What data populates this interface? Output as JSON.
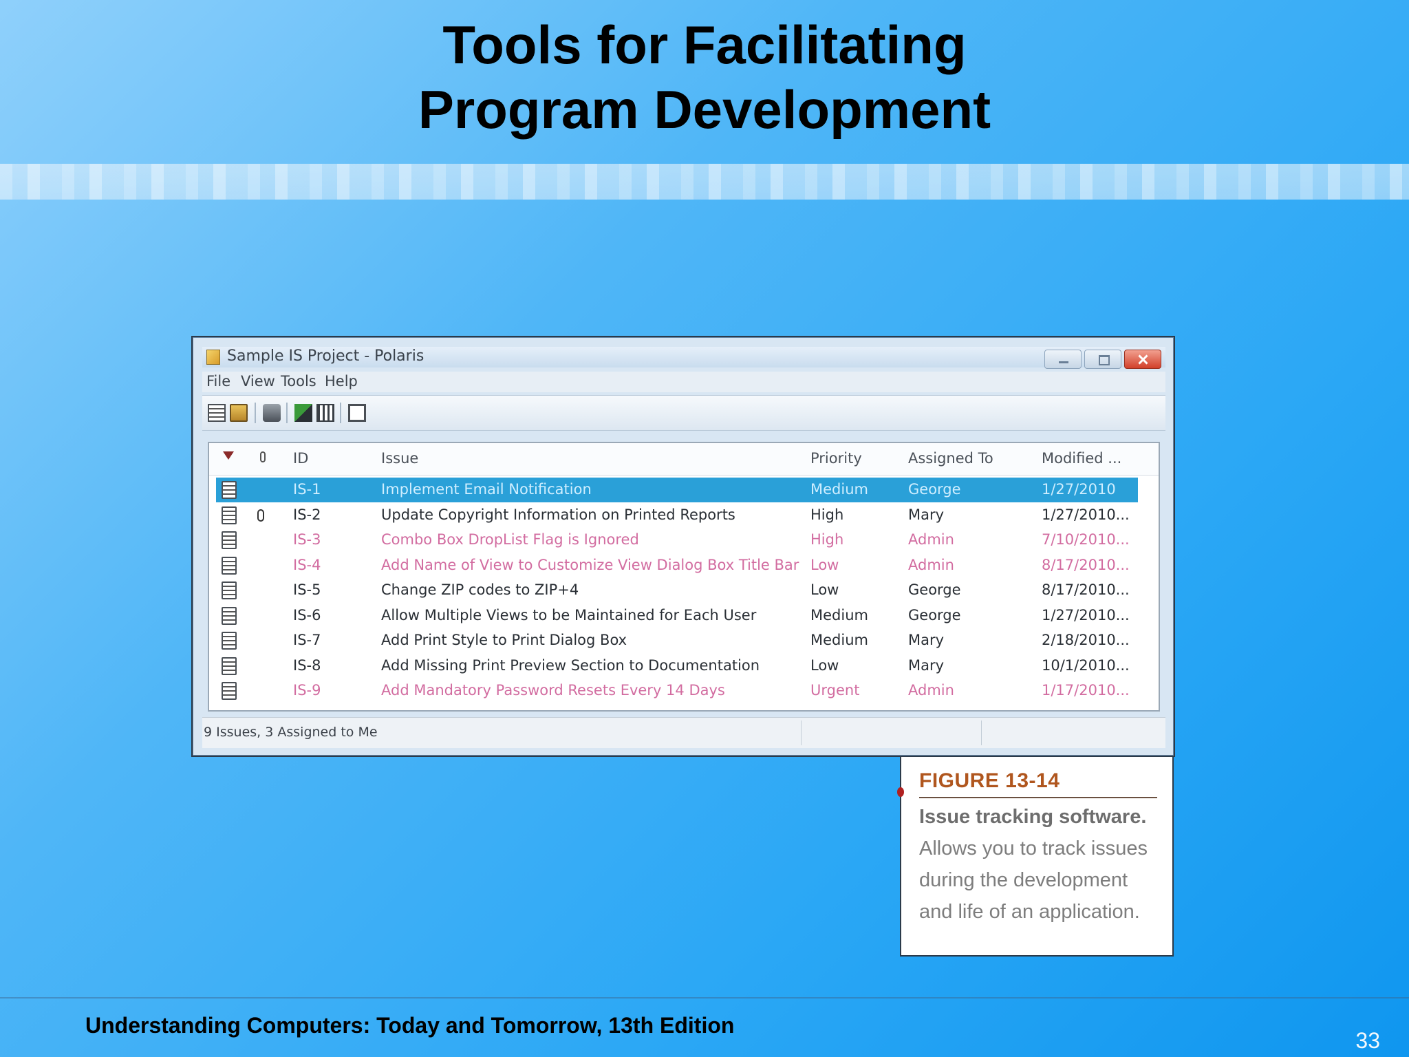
{
  "slide": {
    "title_line1": "Tools for Facilitating",
    "title_line2": "Program Development",
    "footer": "Understanding Computers: Today and Tomorrow, 13th Edition",
    "page_number": "33"
  },
  "window": {
    "title": "Sample IS Project - Polaris",
    "menu": [
      "File",
      "View",
      "Tools",
      "Help"
    ],
    "toolbar_icons": [
      "new-issue-icon",
      "open-folder-icon",
      "print-icon",
      "export-icon",
      "columns-icon",
      "window-icon"
    ],
    "columns": {
      "id": "ID",
      "issue": "Issue",
      "priority": "Priority",
      "assigned_to": "Assigned To",
      "modified": "Modified ..."
    },
    "rows": [
      {
        "id": "IS-1",
        "issue": "Implement Email Notification",
        "priority": "Medium",
        "assigned_to": "George",
        "modified": "1/27/2010",
        "state": "selected",
        "attachment": false
      },
      {
        "id": "IS-2",
        "issue": "Update Copyright Information on Printed Reports",
        "priority": "High",
        "assigned_to": "Mary",
        "modified": "1/27/2010...",
        "state": "normal",
        "attachment": true
      },
      {
        "id": "IS-3",
        "issue": "Combo Box DropList Flag is Ignored",
        "priority": "High",
        "assigned_to": "Admin",
        "modified": "7/10/2010...",
        "state": "pink",
        "attachment": false
      },
      {
        "id": "IS-4",
        "issue": "Add Name of View to Customize View Dialog Box Title Bar",
        "priority": "Low",
        "assigned_to": "Admin",
        "modified": "8/17/2010...",
        "state": "pink",
        "attachment": false
      },
      {
        "id": "IS-5",
        "issue": "Change ZIP codes to ZIP+4",
        "priority": "Low",
        "assigned_to": "George",
        "modified": "8/17/2010...",
        "state": "normal",
        "attachment": false
      },
      {
        "id": "IS-6",
        "issue": "Allow Multiple Views to be Maintained for Each User",
        "priority": "Medium",
        "assigned_to": "George",
        "modified": "1/27/2010...",
        "state": "normal",
        "attachment": false
      },
      {
        "id": "IS-7",
        "issue": "Add Print Style to Print Dialog Box",
        "priority": "Medium",
        "assigned_to": "Mary",
        "modified": "2/18/2010...",
        "state": "normal",
        "attachment": false
      },
      {
        "id": "IS-8",
        "issue": "Add Missing Print Preview Section to Documentation",
        "priority": "Low",
        "assigned_to": "Mary",
        "modified": "10/1/2010...",
        "state": "normal",
        "attachment": false
      },
      {
        "id": "IS-9",
        "issue": "Add Mandatory Password Resets Every 14 Days",
        "priority": "Urgent",
        "assigned_to": "Admin",
        "modified": "1/17/2010...",
        "state": "pink",
        "attachment": false
      }
    ],
    "status": "9 Issues, 3 Assigned to Me"
  },
  "caption": {
    "figure": "FIGURE 13-14",
    "bold": "Issue tracking software.",
    "text": "Allows you to track issues during the development and life of an application."
  },
  "colors": {
    "selected_row": "#2aa0d8",
    "pink_text": "#d26ca0",
    "figure_label": "#b0561e"
  }
}
